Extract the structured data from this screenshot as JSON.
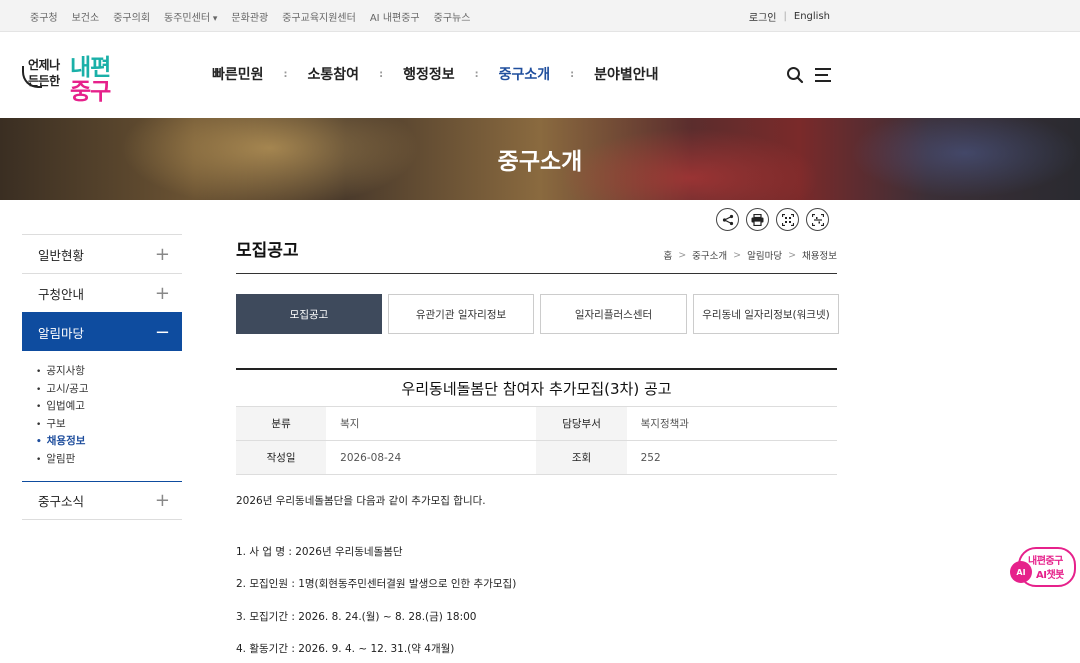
{
  "topbar": {
    "links": [
      "중구청",
      "보건소",
      "중구의회",
      "동주민센터",
      "문화관광",
      "중구교육지원센터",
      "AI 내편중구",
      "중구뉴스"
    ],
    "login": "로그인",
    "language": "English"
  },
  "logo": {
    "line1": "언제나",
    "line2": "든든한",
    "brand1": "내편",
    "brand2": "중구"
  },
  "gnb": {
    "items": [
      "빠른민원",
      "소통참여",
      "행정정보",
      "중구소개",
      "분야별안내"
    ],
    "active_index": 3,
    "icons": [
      "search-icon",
      "menu-icon"
    ]
  },
  "banner": {
    "title": "중구소개"
  },
  "sidebar": {
    "menus": [
      {
        "label": "일반현황",
        "state": "collapsed"
      },
      {
        "label": "구청안내",
        "state": "collapsed"
      },
      {
        "label": "알림마당",
        "state": "expanded"
      },
      {
        "label": "중구소식",
        "state": "collapsed"
      }
    ],
    "sub_items": [
      "공지사항",
      "고시/공고",
      "입법예고",
      "구보",
      "채용정보",
      "알림판"
    ],
    "active_sub_index": 4
  },
  "utilities": [
    "share-icon",
    "print-icon",
    "qr-code-icon",
    "qr-scan-icon"
  ],
  "page": {
    "title": "모집공고",
    "breadcrumb": [
      "홈",
      "중구소개",
      "알림마당",
      "채용정보"
    ]
  },
  "tabs": [
    {
      "label": "모집공고",
      "active": true
    },
    {
      "label": "유관기관 일자리정보",
      "active": false
    },
    {
      "label": "일자리플러스센터",
      "active": false
    },
    {
      "label": "우리동네 일자리정보(워크넷)",
      "active": false
    }
  ],
  "post": {
    "title": "우리동네돌봄단 참여자 추가모집(3차) 공고",
    "meta": {
      "category_label": "분류",
      "category_value": "복지",
      "dept_label": "담당부서",
      "dept_value": "복지정책과",
      "date_label": "작성일",
      "date_value": "2026-08-24",
      "views_label": "조회",
      "views_value": "252"
    },
    "body": [
      "2026년 우리동네돌봄단을 다음과 같이 추가모집 합니다.",
      "1. 사 업 명 : 2026년 우리동네돌봄단",
      "2. 모집인원 : 1명(회현동주민센터결원 발생으로 인한 추가모집)",
      "3. 모집기간 : 2026. 8. 24.(월) ~ 8. 28.(금) 18:00",
      "4. 활동기간 : 2026. 9. 4. ~ 12. 31.(약 4개월)"
    ]
  },
  "chatbot": {
    "badge": "AI",
    "line1": "내편중구",
    "line2": "AI챗봇"
  },
  "colors": {
    "primary_blue": "#0e4c9f",
    "active_tab": "#3e4a5c",
    "brand_teal": "#1ab0a8",
    "brand_pink": "#e6218b"
  }
}
